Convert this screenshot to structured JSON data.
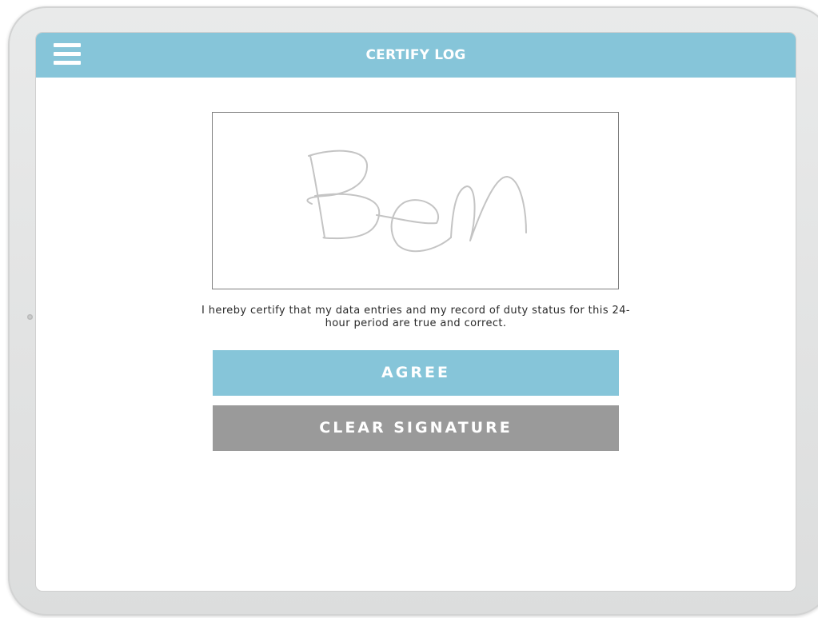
{
  "header": {
    "title": "CERTIFY LOG",
    "menu_icon": "hamburger-menu-icon"
  },
  "signature": {
    "drawn_name": "Ben",
    "stroke_color": "#c4c4c4"
  },
  "certification": {
    "text": "I hereby certify that my data entries and my record of duty status for this 24-hour period are true and correct."
  },
  "actions": {
    "agree_label": "AGREE",
    "clear_label": "CLEAR SIGNATURE"
  },
  "colors": {
    "accent": "#86c5d9",
    "secondary_button": "#9a9a9a",
    "background": "#ffffff"
  }
}
